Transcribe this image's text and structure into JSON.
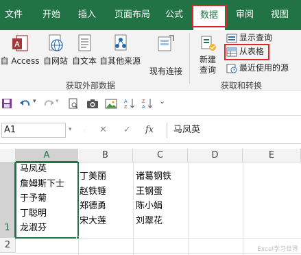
{
  "ribbon_tabs": [
    "文件",
    "开始",
    "插入",
    "页面布局",
    "公式",
    "数据",
    "审阅",
    "视图"
  ],
  "active_tab": "数据",
  "get_external_data": {
    "buttons": [
      "自 Access",
      "自网站",
      "自文本",
      "自其他来源",
      "现有连接"
    ],
    "group_label": "获取外部数据"
  },
  "get_transform": {
    "new_query_label": "新建\n查询",
    "new_query_line1": "新建",
    "new_query_line2": "查询",
    "show_queries": "显示查询",
    "from_table": "从表格",
    "recent_sources": "最近使用的源",
    "group_label": "获取和转换"
  },
  "quick_access": {
    "icons": [
      "save-icon",
      "undo-icon",
      "redo-icon",
      "print-preview-icon",
      "camera-icon",
      "screenshot-icon",
      "sort-ascending-icon",
      "sort-descending-icon",
      "more-icon"
    ]
  },
  "formula_bar": {
    "name_box": "A1",
    "cancel_symbol": "✕",
    "confirm_symbol": "✓",
    "fx_symbol": "fx",
    "content": "马凤英"
  },
  "sheet": {
    "columns": [
      "A",
      "B",
      "C",
      "D",
      "E"
    ],
    "rows": [
      "1",
      "2"
    ],
    "a1_lines": [
      "马凤英",
      "詹姆斯下士",
      "于予菊",
      "丁聪明",
      "龙淑芬"
    ],
    "b1_lines": [
      "丁美丽",
      "赵铁锤",
      "郑德勇",
      "宋大莲"
    ],
    "c1_lines": [
      "诸葛钢铁",
      "王钢蛋",
      "陈小娟",
      "刘翠花"
    ],
    "selected_cell": "A1"
  },
  "watermark": "Excel学习世界",
  "colors": {
    "excel_green": "#217346",
    "highlight_red": "#e0262b"
  }
}
